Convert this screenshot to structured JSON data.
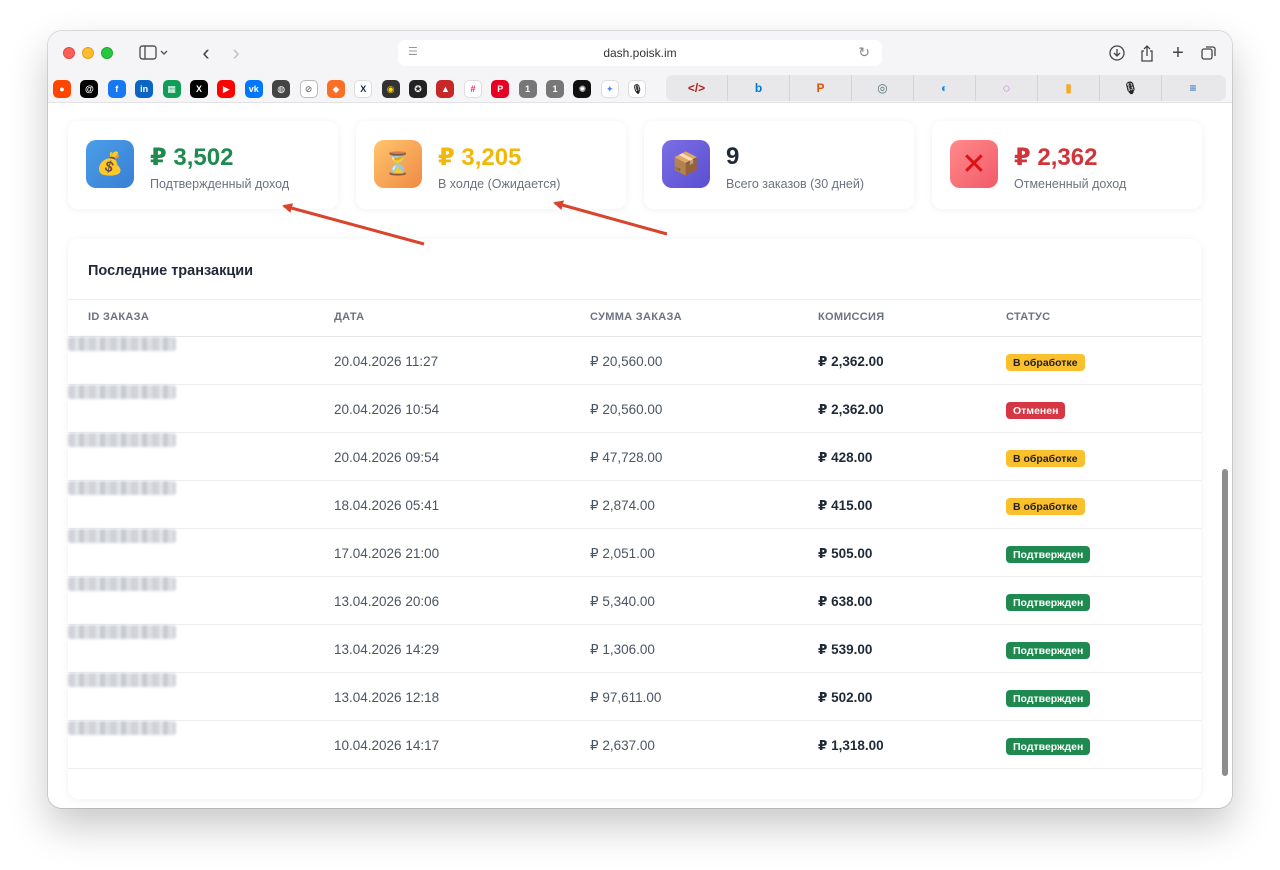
{
  "browser": {
    "url": "dash.poisk.im"
  },
  "stats": [
    {
      "value": "₽ 3,502",
      "label": "Подтвержденный доход",
      "icon": "money-bag-icon",
      "color": "#1e8a4e"
    },
    {
      "value": "₽ 3,205",
      "label": "В холде (Ожидается)",
      "icon": "hourglass-icon",
      "color": "#f1b80b"
    },
    {
      "value": "9",
      "label": "Всего заказов (30 дней)",
      "icon": "package-icon",
      "color": "#1f2937"
    },
    {
      "value": "₽ 2,362",
      "label": "Отмененный доход",
      "icon": "cross-icon",
      "color": "#d0353b"
    }
  ],
  "transactions": {
    "title": "Последние транзакции",
    "headers": [
      "ID ЗАКАЗА",
      "ДАТА",
      "СУММА ЗАКАЗА",
      "КОМИССИЯ",
      "СТАТУС"
    ],
    "rows": [
      {
        "date": "20.04.2026 11:27",
        "sum": "₽ 20,560.00",
        "commission": "₽ 2,362.00",
        "status": "В обработке",
        "status_type": "processing"
      },
      {
        "date": "20.04.2026 10:54",
        "sum": "₽ 20,560.00",
        "commission": "₽ 2,362.00",
        "status": "Отменен",
        "status_type": "cancelled"
      },
      {
        "date": "20.04.2026 09:54",
        "sum": "₽ 47,728.00",
        "commission": "₽ 428.00",
        "status": "В обработке",
        "status_type": "processing"
      },
      {
        "date": "18.04.2026 05:41",
        "sum": "₽ 2,874.00",
        "commission": "₽ 415.00",
        "status": "В обработке",
        "status_type": "processing"
      },
      {
        "date": "17.04.2026 21:00",
        "sum": "₽ 2,051.00",
        "commission": "₽ 505.00",
        "status": "Подтвержден",
        "status_type": "confirmed"
      },
      {
        "date": "13.04.2026 20:06",
        "sum": "₽ 5,340.00",
        "commission": "₽ 638.00",
        "status": "Подтвержден",
        "status_type": "confirmed"
      },
      {
        "date": "13.04.2026 14:29",
        "sum": "₽ 1,306.00",
        "commission": "₽ 539.00",
        "status": "Подтвержден",
        "status_type": "confirmed"
      },
      {
        "date": "13.04.2026 12:18",
        "sum": "₽ 97,611.00",
        "commission": "₽ 502.00",
        "status": "Подтвержден",
        "status_type": "confirmed"
      },
      {
        "date": "10.04.2026 14:17",
        "sum": "₽ 2,637.00",
        "commission": "₽ 1,318.00",
        "status": "Подтвержден",
        "status_type": "confirmed"
      }
    ]
  },
  "colors": {
    "processing": "#fbc02d",
    "cancelled": "#d63744",
    "confirmed": "#1f8a50",
    "annotation_arrow": "#d9442e"
  }
}
